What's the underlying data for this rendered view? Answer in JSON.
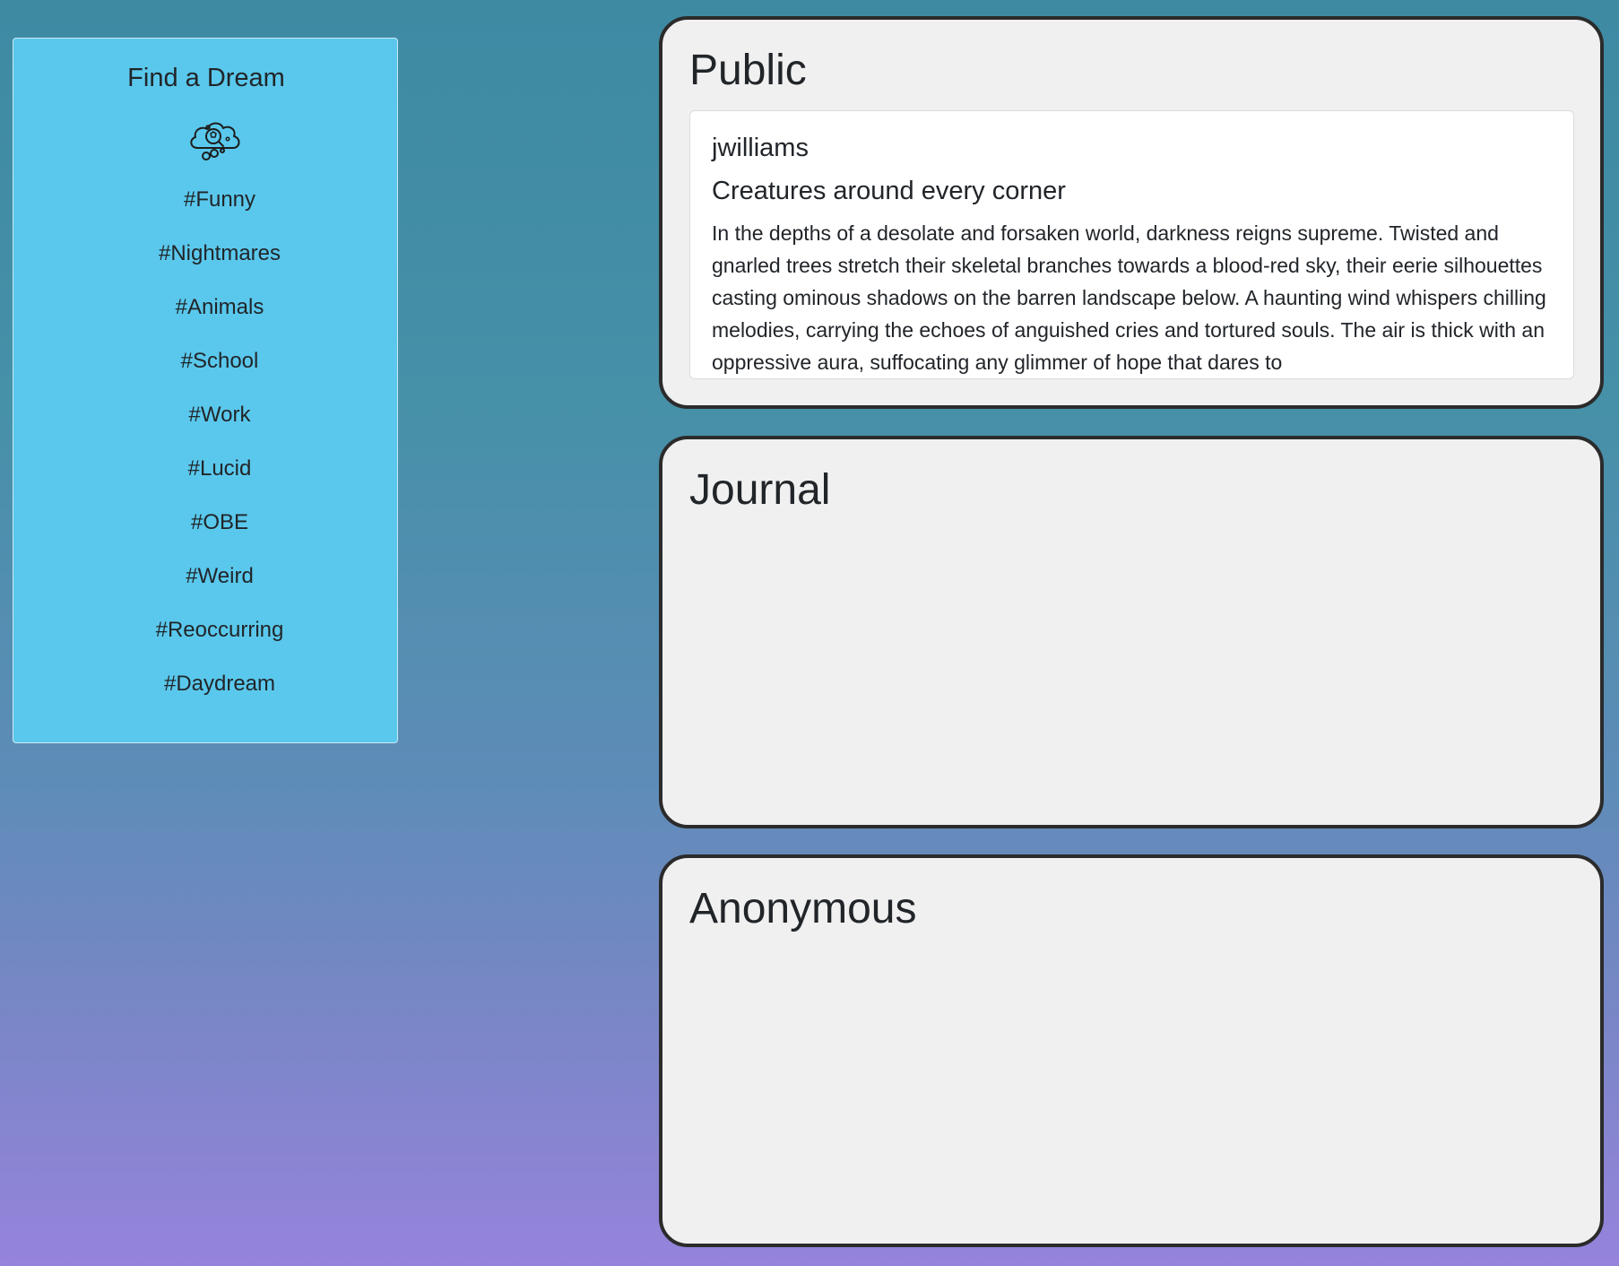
{
  "sidebar": {
    "title": "Find a Dream",
    "logo_icon": "dream-cloud-search-icon",
    "tags": [
      "#Funny",
      "#Nightmares",
      "#Animals",
      "#School",
      "#Work",
      "#Lucid",
      "#OBE",
      "#Weird",
      "#Reoccurring",
      "#Daydream"
    ]
  },
  "panels": {
    "public": {
      "title": "Public",
      "post": {
        "author": "jwilliams",
        "title": "Creatures around every corner",
        "body": "In the depths of a desolate and forsaken world, darkness reigns supreme. Twisted and gnarled trees stretch their skeletal branches towards a blood-red sky, their eerie silhouettes casting ominous shadows on the barren landscape below. A haunting wind whispers chilling melodies, carrying the echoes of anguished cries and tortured souls. The air is thick with an oppressive aura, suffocating any glimmer of hope that dares to"
      }
    },
    "journal": {
      "title": "Journal"
    },
    "anonymous": {
      "title": "Anonymous"
    }
  },
  "colors": {
    "sidebar_bg": "#5ac8ec",
    "panel_bg": "#f0f0f0",
    "panel_border": "#2b2b2b",
    "text": "#212529",
    "background_gradient_top": "#3e8aa3",
    "background_gradient_bottom": "#9683dc"
  }
}
